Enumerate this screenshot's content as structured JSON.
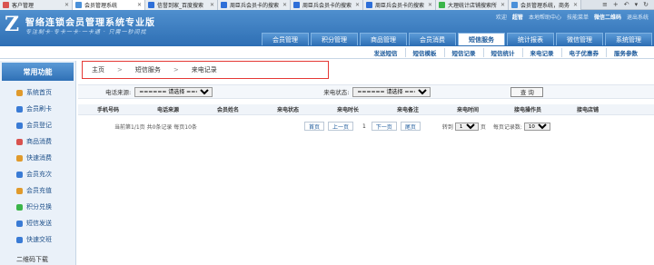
{
  "browser_tabs": [
    {
      "label": "客户管理",
      "color": "#d9534f"
    },
    {
      "label": "会员管理系统",
      "color": "#4a90d9"
    },
    {
      "label": "信誉到家_百度搜索",
      "color": "#2e6fd8"
    },
    {
      "label": "周臣兵会员卡的搜索",
      "color": "#2e6fd8"
    },
    {
      "label": "周臣兵会员卡的搜索",
      "color": "#2e6fd8"
    },
    {
      "label": "周臣兵会员卡的搜索",
      "color": "#2e6fd8"
    },
    {
      "label": "大理统计店铺搜索所",
      "color": "#3bb54a"
    },
    {
      "label": "会员管理系统，商务",
      "color": "#4a90d9"
    }
  ],
  "browser_tools": [
    "≡",
    "+",
    "↶",
    "▾",
    "↻"
  ],
  "app": {
    "logo_mark": "Z",
    "title": "智络连锁会员管理系统专业版",
    "subtitle": "专注制卡·专卡一卡·一卡通 · 只需一秒间找",
    "top_links": [
      "欢迎",
      "超管",
      "本地帮助中心",
      "技能菜单",
      "微信二维码",
      "退出系统"
    ]
  },
  "main_nav": [
    "会员管理",
    "积分管理",
    "商品管理",
    "会员消费",
    "短信服务",
    "统计报表",
    "微信管理",
    "系统管理"
  ],
  "active_nav": "短信服务",
  "sub_nav": [
    "发送短信",
    "短信模板",
    "短信记录",
    "短信统计",
    "来电记录",
    "电子优惠券",
    "服务参数"
  ],
  "sidebar": {
    "title": "常用功能",
    "items": [
      {
        "label": "系统首页",
        "color": "#e09a2c"
      },
      {
        "label": "会员刷卡",
        "color": "#3a7bd5"
      },
      {
        "label": "会员登记",
        "color": "#3a7bd5"
      },
      {
        "label": "商品消费",
        "color": "#d9534f"
      },
      {
        "label": "快速消费",
        "color": "#e09a2c"
      },
      {
        "label": "会员充次",
        "color": "#3a7bd5"
      },
      {
        "label": "会员充值",
        "color": "#e09a2c"
      },
      {
        "label": "积分兑换",
        "color": "#3bb54a"
      },
      {
        "label": "短信发送",
        "color": "#3a7bd5"
      },
      {
        "label": "快速交班",
        "color": "#3a7bd5"
      }
    ],
    "bottom": "二维码下载"
  },
  "breadcrumb": [
    "主页",
    "短信服务",
    "来电记录"
  ],
  "filter": {
    "source_label": "电话来源:",
    "source_value": "====== 请选择 ======",
    "status_label": "来电状态:",
    "status_value": "====== 请选择 ======",
    "query_button": "查 询"
  },
  "table_headers": [
    "手机号码",
    "电话来源",
    "会员姓名",
    "来电状态",
    "来电时长",
    "来电备注",
    "来电时间",
    "接电操作员",
    "接电店铺"
  ],
  "pager": {
    "summary": "当前第1/1页 共0条记录 每页10条",
    "first": "首页",
    "prev": "上一页",
    "page_number": "1",
    "next": "下一页",
    "last": "尾页",
    "goto_label": "转到",
    "goto_value": "1",
    "goto_suffix": "页",
    "per_page_label": "每页记录数:",
    "per_page_value": "10"
  }
}
